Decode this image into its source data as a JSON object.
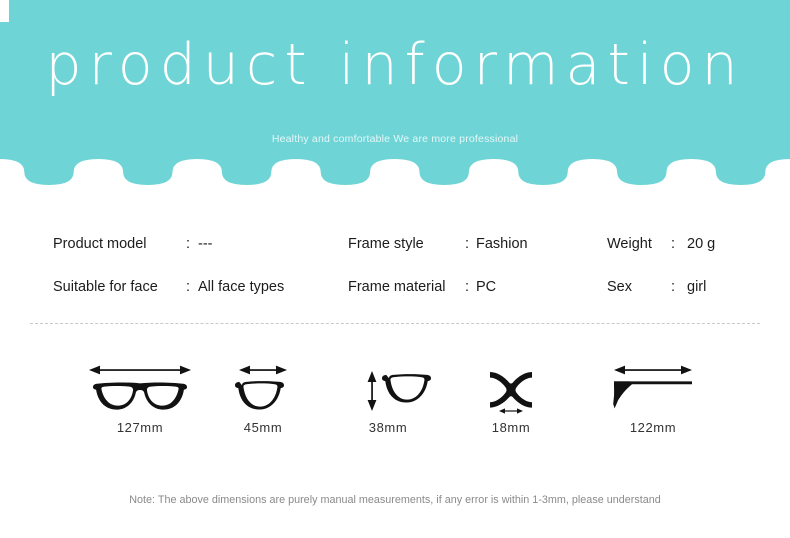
{
  "theme": {
    "banner_color": "#6FD4D6",
    "page_background": "#FFFFFF",
    "title_color": "#FFFFFF",
    "subtitle_color": "#E4F7F7",
    "text_color": "#1C1C1C",
    "note_color": "#8A8A8A",
    "divider_color": "#C9C9C9",
    "diagram_color": "#121212"
  },
  "header": {
    "title": "product information",
    "subtitle": "Healthy and comfortable We are more professional"
  },
  "specs": {
    "rows": [
      [
        {
          "label": "Product model",
          "colon": ":",
          "value": "---"
        },
        {
          "label": "Frame style",
          "colon": ":",
          "value": "Fashion"
        },
        {
          "label": "Weight",
          "colon": ":",
          "value": "20 g"
        }
      ],
      [
        {
          "label": "Suitable for face",
          "colon": ":",
          "value": "All face types"
        },
        {
          "label": "Frame material",
          "colon": ":",
          "value": "PC"
        },
        {
          "label": "Sex",
          "colon": ":",
          "value": "girl"
        }
      ]
    ]
  },
  "dimensions": {
    "items": [
      {
        "icon": "glasses-front-width-icon",
        "label": "127mm"
      },
      {
        "icon": "lens-width-icon",
        "label": "45mm"
      },
      {
        "icon": "lens-height-icon",
        "label": "38mm"
      },
      {
        "icon": "bridge-width-icon",
        "label": "18mm"
      },
      {
        "icon": "temple-arm-length-icon",
        "label": "122mm"
      }
    ]
  },
  "footer": {
    "note": "Note: The above dimensions are purely manual measurements, if any error is within 1-3mm, please understand"
  }
}
